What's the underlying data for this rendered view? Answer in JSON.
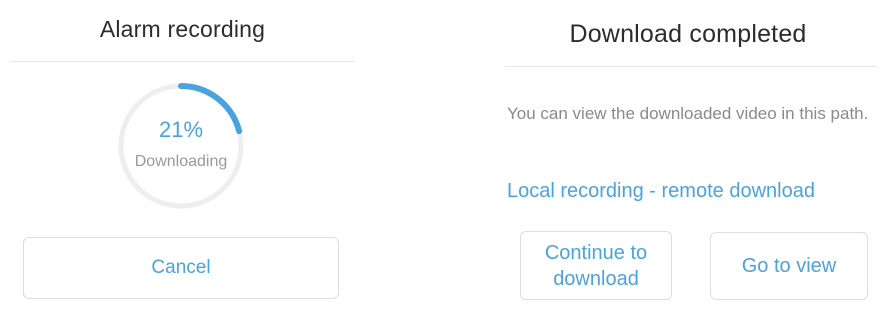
{
  "alarm_dialog": {
    "title": "Alarm recording",
    "progress_percent": "21%",
    "progress_value": 0.21,
    "status": "Downloading",
    "cancel_label": "Cancel",
    "colors": {
      "accent": "#4aa3de",
      "track": "#eeeeee"
    }
  },
  "download_dialog": {
    "title": "Download completed",
    "message": "You can view the downloaded video in this path.",
    "path_link": "Local recording - remote download",
    "continue_label": "Continue to download",
    "view_label": "Go to view"
  }
}
